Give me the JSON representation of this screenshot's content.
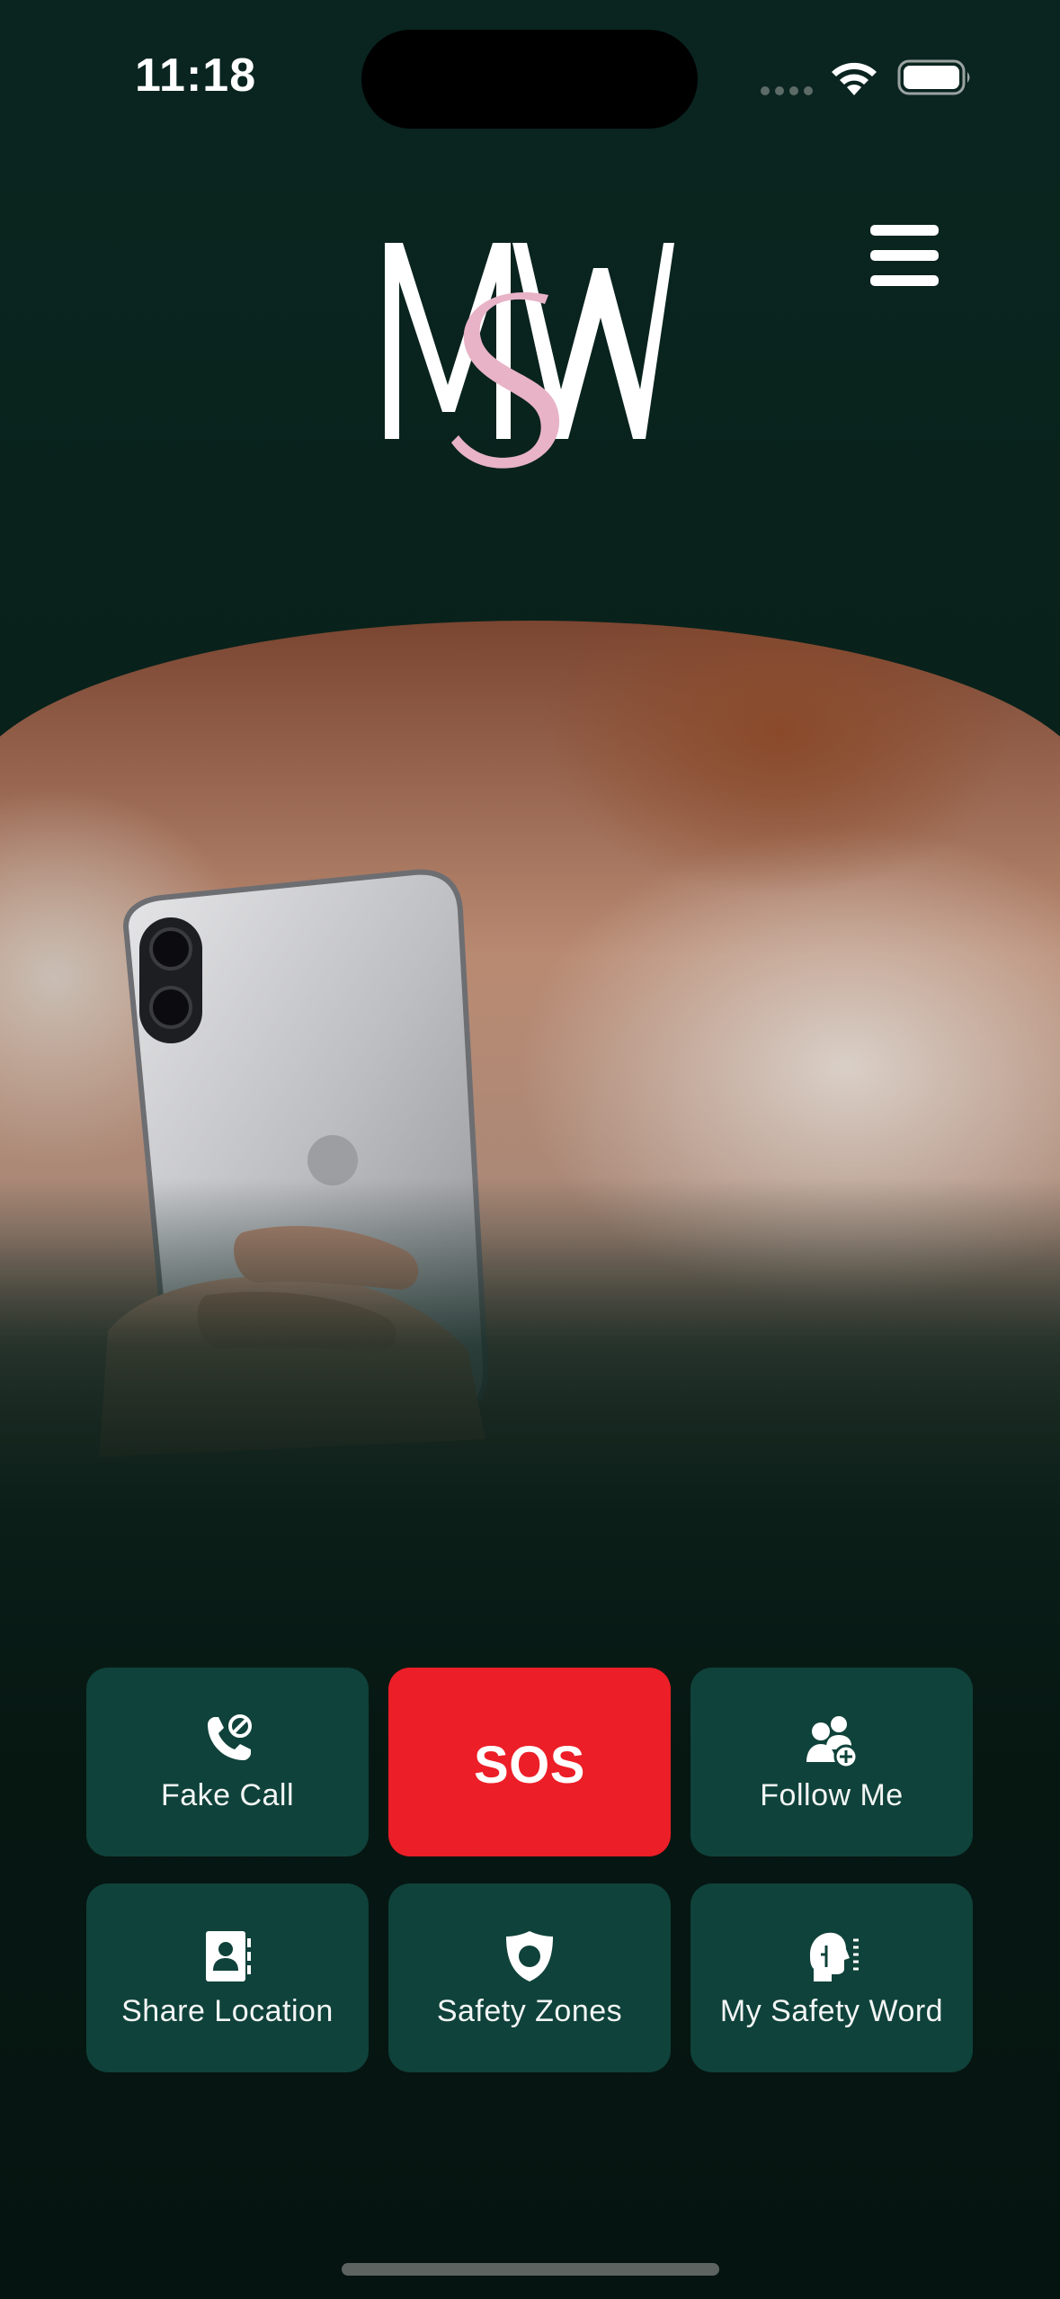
{
  "status_bar": {
    "time": "11:18",
    "icons": [
      "cellular-signal-icon",
      "wifi-icon",
      "battery-icon"
    ]
  },
  "header": {
    "logo": "MSW monogram logo",
    "menu_icon": "hamburger-menu-icon"
  },
  "colors": {
    "background": "#082019",
    "tile": "#0f423a",
    "sos": "#ec1e27",
    "logo_accent": "#e8b3c6"
  },
  "actions": {
    "fake_call": {
      "label": "Fake Call",
      "icon": "phone-blocked-icon"
    },
    "sos": {
      "label": "SOS"
    },
    "follow_me": {
      "label": "Follow Me",
      "icon": "add-people-icon"
    },
    "share_location": {
      "label": "Share Location",
      "icon": "contact-book-icon"
    },
    "safety_zones": {
      "label": "Safety Zones",
      "icon": "shield-icon"
    },
    "my_safety_word": {
      "label": "My Safety Word",
      "icon": "speaking-head-icon"
    }
  }
}
